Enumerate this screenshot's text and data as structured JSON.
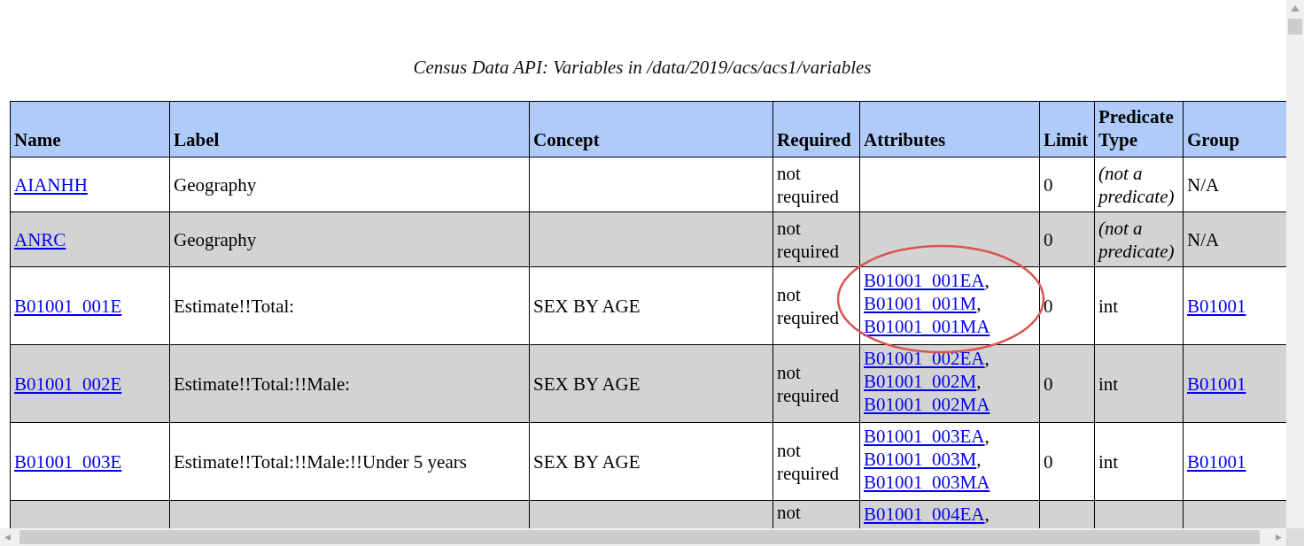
{
  "title": "Census Data API: Variables in /data/2019/acs/acs1/variables",
  "columns": [
    "Name",
    "Label",
    "Concept",
    "Required",
    "Attributes",
    "Limit",
    "Predicate Type",
    "Group"
  ],
  "rows": [
    {
      "name": "AIANHH",
      "label": "Geography",
      "required": "not required",
      "attributes": [],
      "limit": "0",
      "predicate_type": "(not a predicate)",
      "predicate_italic": true,
      "group": "N/A",
      "group_link": false,
      "highlighted": false
    },
    {
      "name": "ANRC",
      "label": "Geography",
      "required": "not required",
      "attributes": [],
      "limit": "0",
      "predicate_type": "(not a predicate)",
      "predicate_italic": true,
      "group": "N/A",
      "group_link": false,
      "highlighted": false
    },
    {
      "name": "B01001_001E",
      "label": "Estimate!!Total:",
      "concept": "SEX BY AGE",
      "required": "not required",
      "attributes": [
        {
          "code": "B01001_001EA",
          "sep": ","
        },
        {
          "code": "B01001_001M",
          "sep": ","
        },
        {
          "code": "B01001_001MA"
        }
      ],
      "limit": "0",
      "predicate_type": "int",
      "predicate_italic": false,
      "group": "B01001",
      "group_link": true,
      "highlighted": true
    },
    {
      "name": "B01001_002E",
      "label": "Estimate!!Total:!!Male:",
      "concept": "SEX BY AGE",
      "required": "not required",
      "attributes": [
        {
          "code": "B01001_002EA",
          "sep": ","
        },
        {
          "code": "B01001_002M",
          "sep": ","
        },
        {
          "code": "B01001_002MA"
        }
      ],
      "limit": "0",
      "predicate_type": "int",
      "predicate_italic": false,
      "group": "B01001",
      "group_link": true,
      "highlighted": false
    },
    {
      "name": "B01001_003E",
      "label": "Estimate!!Total:!!Male:!!Under 5 years",
      "concept": "SEX BY AGE",
      "required": "not required",
      "attributes": [
        {
          "code": "B01001_003EA",
          "sep": ","
        },
        {
          "code": "B01001_003M",
          "sep": ","
        },
        {
          "code": "B01001_003MA"
        }
      ],
      "limit": "0",
      "predicate_type": "int",
      "predicate_italic": false,
      "group": "B01001",
      "group_link": true,
      "highlighted": false
    },
    {
      "required": "not",
      "attributes": [
        {
          "code": "B01001_004EA",
          "sep": ","
        }
      ],
      "highlighted": false
    }
  ]
}
